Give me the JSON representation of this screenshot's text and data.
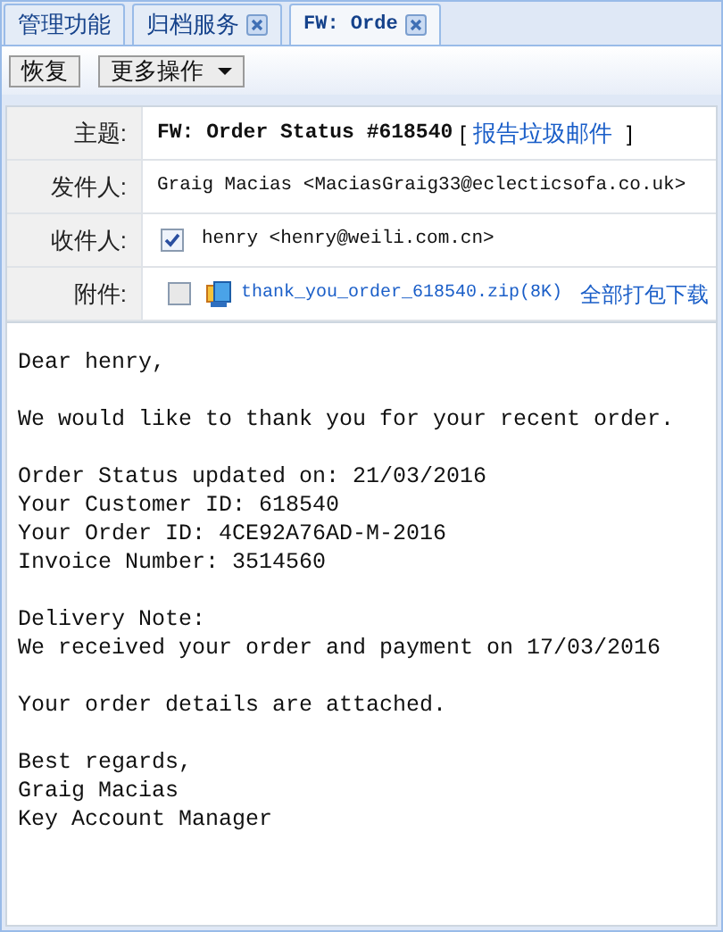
{
  "tabs": [
    {
      "label": "管理功能",
      "closable": false,
      "selected": false
    },
    {
      "label": "归档服务",
      "closable": true,
      "selected": false
    },
    {
      "label": "FW: Orde",
      "closable": true,
      "selected": true
    }
  ],
  "toolbar": [
    {
      "label": "恢复",
      "kind": "button"
    },
    {
      "label": "更多操作",
      "kind": "dropdown"
    }
  ],
  "header": {
    "subject_label": "主题:",
    "subject": "FW: Order Status #618540",
    "report_open": "[",
    "report_link": "报告垃圾邮件",
    "report_close": "]",
    "from_label": "发件人:",
    "from": "Graig Macias <MaciasGraig33@eclecticsofa.co.uk>",
    "to_label": "收件人:",
    "to": {
      "checked": true,
      "text": "henry <henry@weili.com.cn>"
    },
    "attachment_label": "附件:",
    "attachment": {
      "checked": false,
      "filename": "thank_you_order_618540.zip",
      "size": "(8K)",
      "download_all": "全部打包下载"
    }
  },
  "body": [
    [
      "Dear henry,"
    ],
    [
      "We would like to thank you for your recent order."
    ],
    [
      "Order Status updated on: 21/03/2016",
      "Your Customer ID: 618540",
      "Your Order ID: 4CE92A76AD-M-2016",
      "Invoice Number: 3514560"
    ],
    [
      "Delivery Note:",
      "We received your order and payment on 17/03/2016"
    ],
    [
      "Your order details are attached."
    ],
    [
      "Best regards,",
      "Graig Macias",
      "Key Account Manager"
    ]
  ]
}
